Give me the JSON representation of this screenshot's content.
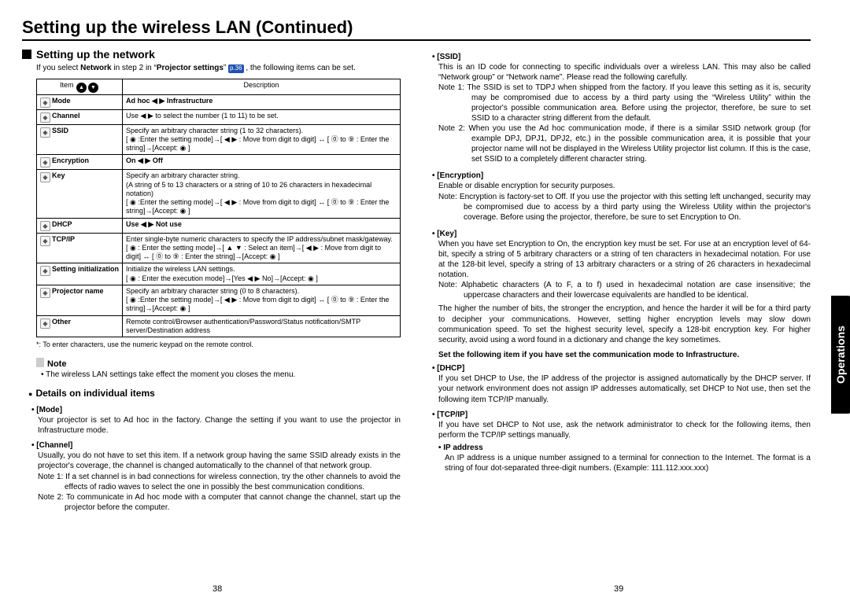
{
  "title": "Setting up the wireless LAN (Continued)",
  "section_tab": "Operations",
  "page_left": "38",
  "page_right": "39",
  "left": {
    "subhead": "Setting up the network",
    "intro_prefix": "If you select ",
    "intro_bold1": "Network",
    "intro_mid1": " in step 2 in “",
    "intro_bold2": "Projector settings",
    "intro_mid2": "” ",
    "pageref": "p.36",
    "intro_suffix": " , the following items can be set.",
    "table": {
      "h1": "Item",
      "h2": "Description",
      "rows": [
        {
          "item": "Mode",
          "desc": "Ad hoc ◀ ▶ Infrastructure",
          "bold": true
        },
        {
          "item": "Channel",
          "desc": "Use ◀ ▶ to select the number (1 to 11) to be set."
        },
        {
          "item": "SSID",
          "desc": "Specify an arbitrary character string (1 to 32 characters).\n[ ◉ :Enter the setting mode]→[ ◀ ▶ : Move from digit to digit] ↔ [ ⓪ to ⑨ : Enter the string]→[Accept: ◉ ]"
        },
        {
          "item": "Encryption",
          "desc": "On ◀ ▶ Off",
          "bold": true
        },
        {
          "item": "Key",
          "desc": "Specify an arbitrary character string.\n(A string of 5 to 13 characters or a string of 10 to 26 characters in hexadecimal notation)\n[ ◉ :Enter the setting mode]→[ ◀ ▶ : Move from digit to digit] ↔ [ ⓪ to ⑨ : Enter the string]→[Accept: ◉ ]"
        },
        {
          "item": "DHCP",
          "desc": "Use ◀ ▶ Not use",
          "bold": true
        },
        {
          "item": "TCP/IP",
          "desc": "Enter single-byte numeric characters to specify the IP address/subnet mask/gateway.\n[ ◉ : Enter the setting mode]→[ ▲ ▼ : Select an item]→[ ◀ ▶ : Move from digit to digit] ↔ [ ⓪ to ⑨ : Enter the string]→[Accept: ◉ ]"
        },
        {
          "item": "Setting initialization",
          "desc": "Initialize the wireless LAN settings.\n[ ◉ : Enter the execution mode]→[Yes ◀ ▶ No]→[Accept: ◉ ]"
        },
        {
          "item": "Projector name",
          "desc": "Specify an arbitrary character string (0 to 8 characters).\n[ ◉ :Enter the setting mode]→[ ◀ ▶ : Move from digit to digit] ↔ [ ⓪ to ⑨ : Enter the string]→[Accept: ◉ ]"
        },
        {
          "item": "Other",
          "desc": "Remote control/Browser authentication/Password/Status notification/SMTP server/Destination address"
        }
      ]
    },
    "footnote": "*: To enter characters, use the numeric keypad on the remote control.",
    "note_label": "Note",
    "note_body": "• The wireless LAN settings take effect the moment you closes the menu.",
    "details_head": "Details on individual items",
    "mode_h": "[Mode]",
    "mode_body": "Your projector is set to Ad hoc in the factory. Change the setting if you want to use the projector in Infrastructure mode.",
    "channel_h": "[Channel]",
    "channel_body": "Usually, you do not have to set this item. If a network group having the same SSID already exists in the projector's coverage, the channel is changed automatically to the channel of that network group.",
    "channel_n1": "Note 1:  If a set channel is in bad connections for wireless connection, try the other channels to avoid the effects of radio waves to select the one in possibly the best communication conditions.",
    "channel_n2": "Note 2:  To communicate in Ad hoc mode with a computer that cannot change the channel, start up the projector before the computer."
  },
  "right": {
    "ssid_h": "[SSID]",
    "ssid_body": "This is an ID code for connecting to specific individuals over a wireless LAN.  This may also be called “Network group” or “Network name”.  Please read the following carefully.",
    "ssid_n1": "Note 1:  The SSID is set to TDPJ when shipped from the factory. If you leave this setting as it is, security may be compromised due to access by a third party using the “Wireless Utility” within the projector's possible communication area. Before using the projector, therefore, be sure to set SSID to a character string different from the default.",
    "ssid_n2": "Note 2:  When you use the Ad hoc communication mode, if there is a similar SSID network group (for example DPJ, DPJ1, DPJ2, etc.) in the possible communication area, it is possible that your projector name will not be displayed in the Wireless Utility projector list column. If this is the case, set SSID to a completely different character string.",
    "enc_h": "[Encryption]",
    "enc_body": "Enable or disable encryption for security purposes.",
    "enc_note": "Note:  Encryption is factory-set to Off. If you use the projector with this setting left unchanged, security may be compromised due to access by a third party using the Wireless Utility within the projector's coverage. Before using the projector, therefore, be sure to set Encryption to On.",
    "key_h": "[Key]",
    "key_body": "When you have set Encryption to On, the encryption key must be set. For use at an encryption level of 64-bit, specify a string of 5 arbitrary characters or a string of ten characters in hexadecimal notation. For use at the 128-bit level, specify a string of 13 arbitrary characters or a string of 26 characters in hexadecimal notation.",
    "key_note": "Note:  Alphabetic characters (A to F, a to f) used in hexadecimal notation are case insensitive; the uppercase characters and their lowercase equivalents are handled to be identical.",
    "key_para": "The higher the number of bits, the stronger the encryption, and hence the harder it will be for a third party to decipher your communications. However, setting higher encryption levels may slow down communication speed. To set the highest security level, specify a 128-bit encryption key. For higher security, avoid using a word found in a dictionary and change the key sometimes.",
    "infra_line": "Set the following item if you have set the communication mode to Infrastructure.",
    "dhcp_h": "[DHCP]",
    "dhcp_body": "If you set DHCP to Use, the IP address of the projector is assigned automatically by the DHCP server. If your network environment does not assign IP addresses automatically, set DHCP to Not use, then set the following item TCP/IP manually.",
    "tcpip_h": "[TCP/IP]",
    "tcpip_body": "If you have set DHCP to Not use, ask the network administrator to check for the following items, then perform the TCP/IP settings manually.",
    "ip_h": "IP address",
    "ip_body": "An IP address is a unique number assigned to a terminal for connection to the Internet. The format is a string of four dot-separated three-digit numbers. (Example: 111.112.xxx.xxx)"
  }
}
